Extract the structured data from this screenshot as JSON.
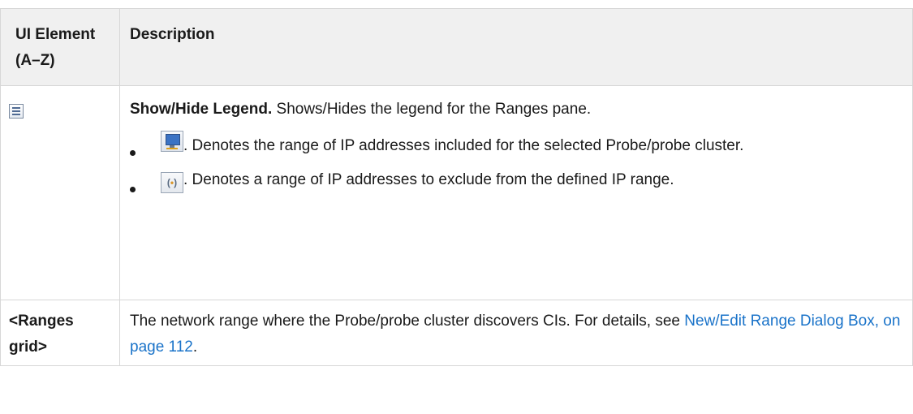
{
  "table": {
    "header": {
      "col1": "UI Element (A–Z)",
      "col2": "Description"
    },
    "rows": [
      {
        "element_icon": "legend-icon",
        "title": "Show/Hide Legend.",
        "description": "Shows/Hides the legend for the Ranges pane.",
        "legend_items": [
          {
            "icon": "included-range-icon",
            "text": ". Denotes the range of IP addresses included for the selected Probe/probe cluster."
          },
          {
            "icon": "excluded-range-icon",
            "text": ". Denotes a range of IP addresses to exclude from the defined IP range."
          }
        ]
      },
      {
        "element": "<Ranges grid>",
        "description": "The network range where the Probe/probe cluster discovers CIs. For details, see",
        "link_text": "New/Edit Range Dialog Box, on page 112",
        "trailing": "."
      }
    ]
  },
  "colors": {
    "link": "#1a73c9",
    "header_bg": "#f0f0f0",
    "border": "#d7d7d7"
  }
}
